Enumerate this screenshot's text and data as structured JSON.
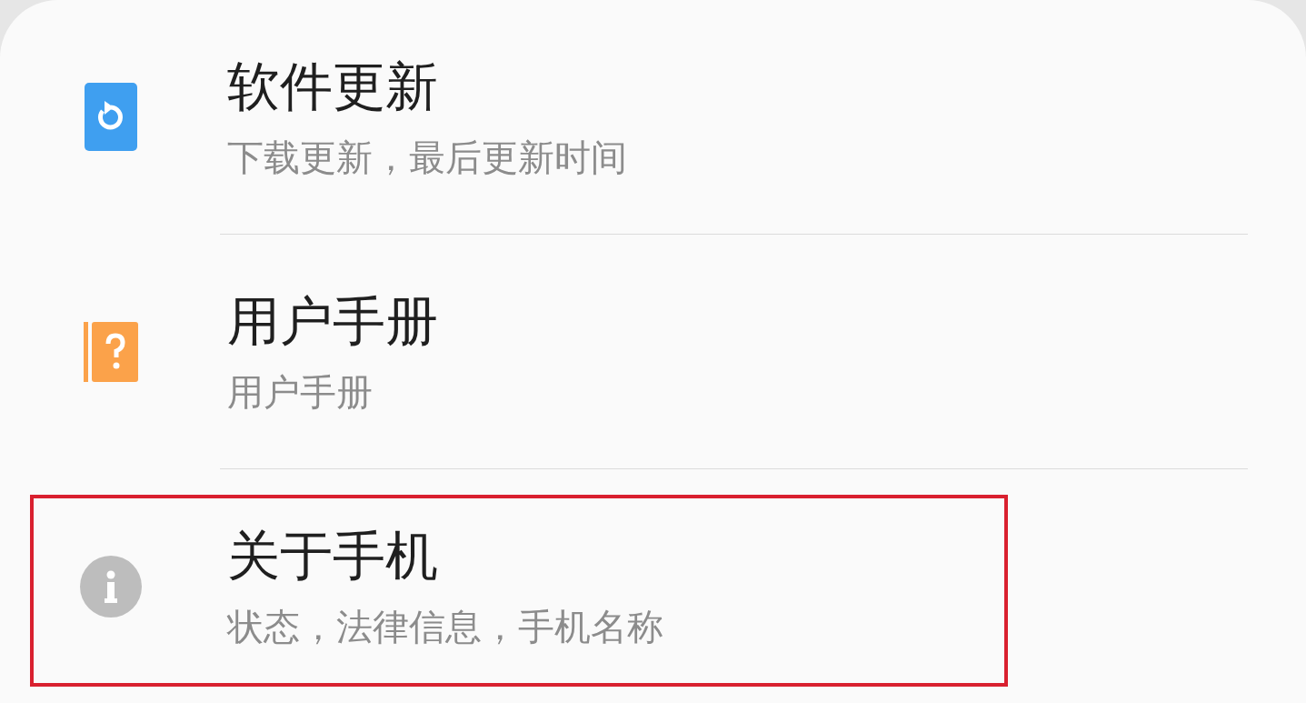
{
  "items": [
    {
      "kind": "update",
      "title": "软件更新",
      "subtitle": "下载更新，最后更新时间",
      "highlighted": false
    },
    {
      "kind": "manual",
      "title": "用户手册",
      "subtitle": "用户手册",
      "highlighted": false
    },
    {
      "kind": "about",
      "title": "关于手机",
      "subtitle": "状态，法律信息，手机名称",
      "highlighted": true
    }
  ]
}
